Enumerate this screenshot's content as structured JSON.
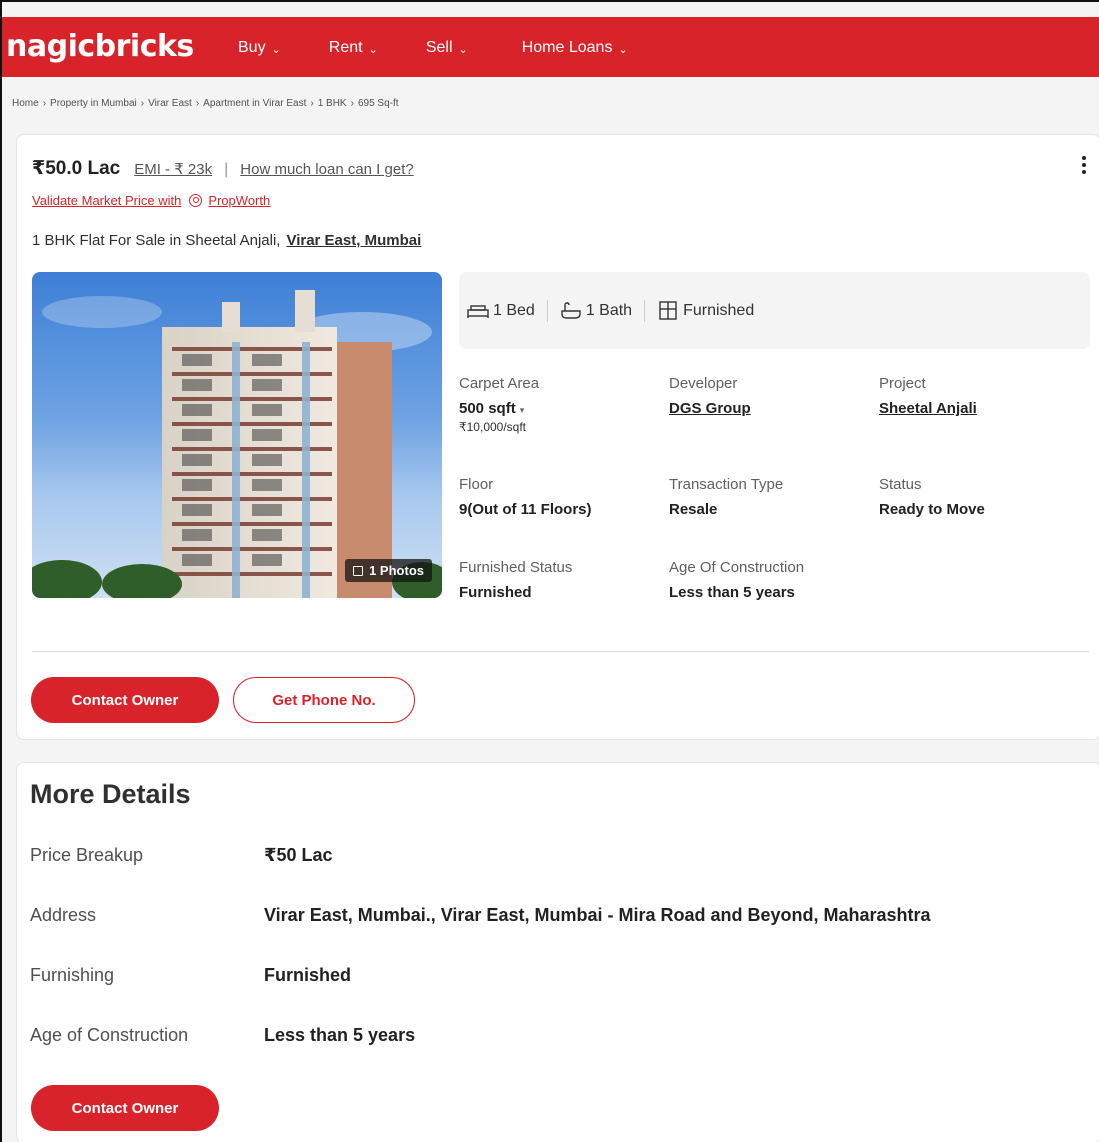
{
  "header": {
    "logo": "nagicbricks",
    "nav": [
      {
        "label": "Buy"
      },
      {
        "label": "Rent"
      },
      {
        "label": "Sell"
      },
      {
        "label": "Home Loans"
      }
    ]
  },
  "breadcrumb": [
    "Home",
    "Property in Mumbai",
    "Virar East",
    "Apartment in Virar East",
    "1 BHK",
    "695 Sq-ft"
  ],
  "listing": {
    "price": "₹50.0 Lac",
    "emi": "EMI - ₹ 23k",
    "divider": "|",
    "loan_link": "How much loan can I get?",
    "validate_text": "Validate Market Price with",
    "propworth": "PropWorth",
    "title": "1 BHK Flat For Sale in Sheetal Anjali,",
    "location_link": "Virar East, Mumbai",
    "photo_badge": "1 Photos",
    "summary": {
      "bed": "1 Bed",
      "bath": "1 Bath",
      "furnish": "Furnished"
    },
    "details": {
      "carpet_label": "Carpet Area",
      "carpet_value": "500 sqft",
      "carpet_rate": "₹10,000/sqft",
      "developer_label": "Developer",
      "developer_value": "DGS Group",
      "project_label": "Project",
      "project_value": "Sheetal Anjali",
      "floor_label": "Floor",
      "floor_value": "9(Out of 11 Floors)",
      "transaction_label": "Transaction Type",
      "transaction_value": "Resale",
      "status_label": "Status",
      "status_value": "Ready to Move",
      "furnished_label": "Furnished Status",
      "furnished_value": "Furnished",
      "age_label": "Age Of Construction",
      "age_value": "Less than 5 years"
    },
    "contact_owner": "Contact Owner",
    "get_phone": "Get Phone No."
  },
  "more_details": {
    "title": "More Details",
    "rows": [
      {
        "key": "Price Breakup",
        "value": "₹50 Lac"
      },
      {
        "key": "Address",
        "value": "Virar East, Mumbai., Virar East, Mumbai - Mira Road and Beyond, Maharashtra"
      },
      {
        "key": "Furnishing",
        "value": "Furnished"
      },
      {
        "key": "Age of Construction",
        "value": "Less than 5 years"
      }
    ],
    "contact_owner": "Contact Owner"
  },
  "colors": {
    "brand": "#d8232a"
  }
}
